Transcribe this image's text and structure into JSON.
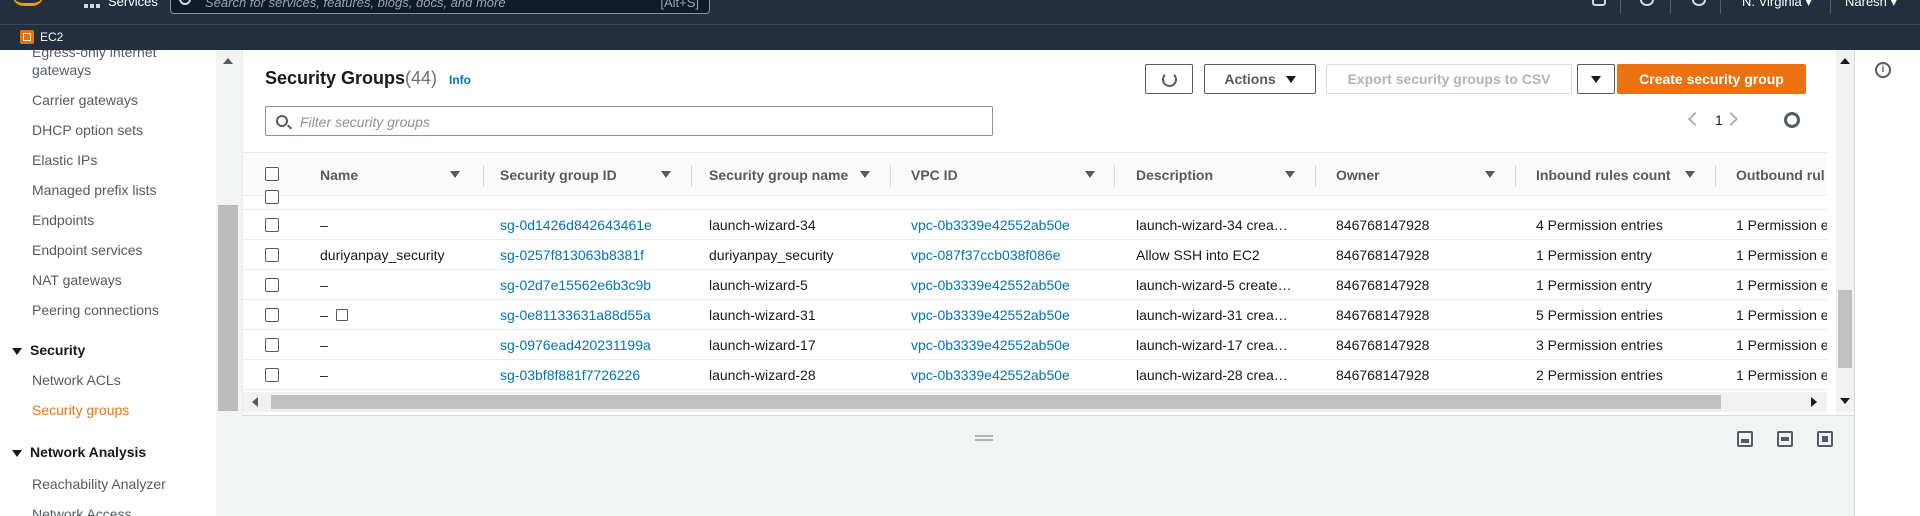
{
  "topnav": {
    "services_label": "Services",
    "search_placeholder": "Search for services, features, blogs, docs, and more",
    "search_shortcut": "[Alt+S]",
    "region": "N. Virginia ▾",
    "user": "Naresh ▾"
  },
  "servicebar": {
    "service": "EC2"
  },
  "sidebar": {
    "items_top": [
      "Egress-only internet",
      "gateways",
      "Carrier gateways",
      "DHCP option sets",
      "Elastic IPs",
      "Managed prefix lists",
      "Endpoints",
      "Endpoint services",
      "NAT gateways",
      "Peering connections"
    ],
    "security_section": "Security",
    "security_items": [
      "Network ACLs",
      "Security groups"
    ],
    "network_section": "Network Analysis",
    "network_items": [
      "Reachability Analyzer",
      "Network Access"
    ]
  },
  "panel": {
    "title": "Security Groups",
    "count": "(44)",
    "info": "Info",
    "actions_label": "Actions",
    "export_label": "Export security groups to CSV",
    "create_label": "Create security group",
    "filter_placeholder": "Filter security groups",
    "page": "1"
  },
  "table": {
    "headers": [
      "Name",
      "Security group ID",
      "Security group name",
      "VPC ID",
      "Description",
      "Owner",
      "Inbound rules count",
      "Outbound rul"
    ],
    "rows": [
      {
        "name": "–",
        "id": "sg-0d1426d842643461e",
        "group_name": "launch-wizard-34",
        "vpc": "vpc-0b3339e42552ab50e",
        "description": "launch-wizard-34 crea…",
        "owner": "846768147928",
        "inbound": "4 Permission entries",
        "outbound": "1 Permission e"
      },
      {
        "name": "duriyanpay_security",
        "id": "sg-0257f813063b8381f",
        "group_name": "duriyanpay_security",
        "vpc": "vpc-087f37ccb038f086e",
        "description": "Allow SSH into EC2",
        "owner": "846768147928",
        "inbound": "1 Permission entry",
        "outbound": "1 Permission e"
      },
      {
        "name": "–",
        "id": "sg-02d7e15562e6b3c9b",
        "group_name": "launch-wizard-5",
        "vpc": "vpc-0b3339e42552ab50e",
        "description": "launch-wizard-5 create…",
        "owner": "846768147928",
        "inbound": "1 Permission entry",
        "outbound": "1 Permission e"
      },
      {
        "name": "–",
        "id": "sg-0e81133631a88d55a",
        "group_name": "launch-wizard-31",
        "vpc": "vpc-0b3339e42552ab50e",
        "description": "launch-wizard-31 crea…",
        "owner": "846768147928",
        "inbound": "5 Permission entries",
        "outbound": "1 Permission e"
      },
      {
        "name": "–",
        "id": "sg-0976ead420231199a",
        "group_name": "launch-wizard-17",
        "vpc": "vpc-0b3339e42552ab50e",
        "description": "launch-wizard-17 crea…",
        "owner": "846768147928",
        "inbound": "3 Permission entries",
        "outbound": "1 Permission e"
      },
      {
        "name": "–",
        "id": "sg-03bf8f881f7726226",
        "group_name": "launch-wizard-28",
        "vpc": "vpc-0b3339e42552ab50e",
        "description": "launch-wizard-28 crea…",
        "owner": "846768147928",
        "inbound": "2 Permission entries",
        "outbound": "1 Permission e"
      }
    ]
  },
  "colors": {
    "nav_bg": "#232f3e",
    "accent": "#ec7211",
    "link": "#0073bb"
  }
}
